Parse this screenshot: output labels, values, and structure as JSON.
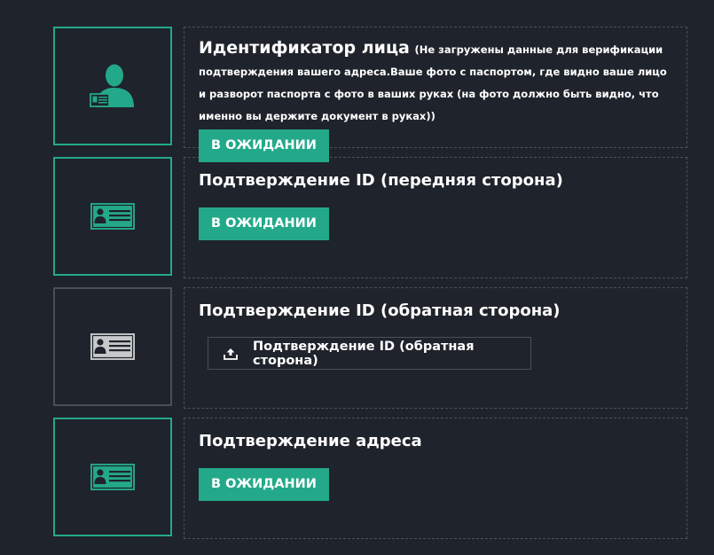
{
  "colors": {
    "background": "#1f232b",
    "accent": "#23a98a",
    "inactive": "#4a4e55",
    "text": "#ffffff"
  },
  "items": [
    {
      "icon": "person-with-id-icon",
      "title": "Идентификатор лица",
      "note": "(Не загружены данные для верификации подтверждения вашего адреса.Ваше фото с паспортом, где видно ваше лицо и разворот паспорта с фото в ваших руках (на фото должно быть видно, что именно вы держите документ в руках))",
      "status_label": "В ОЖИДАНИИ"
    },
    {
      "icon": "id-card-icon",
      "title": "Подтверждение ID (передняя сторона)",
      "status_label": "В ОЖИДАНИИ"
    },
    {
      "icon": "id-card-icon",
      "title": "Подтверждение ID (обратная сторона)",
      "upload_icon": "upload-icon",
      "upload_label": "Подтверждение ID (обратная сторона)"
    },
    {
      "icon": "id-card-icon",
      "title": "Подтверждение адреса",
      "status_label": "В ОЖИДАНИИ"
    }
  ]
}
